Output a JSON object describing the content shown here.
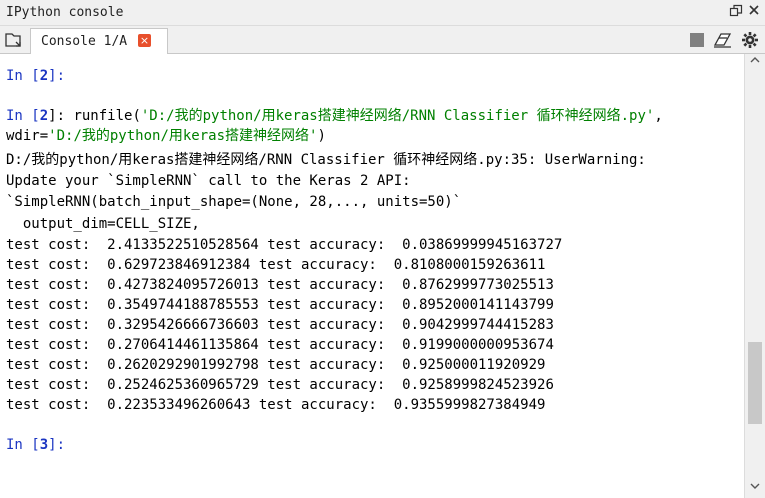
{
  "pane": {
    "title": "IPython console",
    "undock_icon": "undock-icon",
    "close_icon": "close-icon"
  },
  "tab": {
    "label": "Console 1/A",
    "close_label": "×"
  },
  "toolbar": {
    "browse_icon": "browse-tabs-icon",
    "stop_icon": "stop-icon",
    "clear_icon": "eraser-icon",
    "options_icon": "gear-icon"
  },
  "console": {
    "prompt1": {
      "prefix": "In [",
      "num": "2",
      "suffix": "]:"
    },
    "run_line": {
      "prefix": "In [",
      "num": "2",
      "mid": "]: runfile(",
      "path": "'D:/我的python/用keras搭建神经网络/RNN Classifier 循环神经网络.py'",
      "tail": ","
    },
    "wdir_line": {
      "prefix": "wdir=",
      "path": "'D:/我的python/用keras搭建神经网络'",
      "tail": ")"
    },
    "output": [
      "D:/我的python/用keras搭建神经网络/RNN Classifier 循环神经网络.py:35: UserWarning:",
      "Update your `SimpleRNN` call to the Keras 2 API:",
      "`SimpleRNN(batch_input_shape=(None, 28,..., units=50)`",
      "  output_dim=CELL_SIZE,",
      "test cost:  2.4133522510528564 test accuracy:  0.03869999945163727",
      "test cost:  0.629723846912384 test accuracy:  0.8108000159263611",
      "test cost:  0.4273824095726013 test accuracy:  0.8762999773025513",
      "test cost:  0.3549744188785553 test accuracy:  0.8952000141143799",
      "test cost:  0.3295426666736603 test accuracy:  0.9042999744415283",
      "test cost:  0.2706414461135864 test accuracy:  0.9199000000953674",
      "test cost:  0.2620292901992798 test accuracy:  0.925000011920929",
      "test cost:  0.2524625360965729 test accuracy:  0.9258999824523926",
      "test cost:  0.223533496260643 test accuracy:  0.9355999827384949"
    ],
    "prompt2": {
      "prefix": "In [",
      "num": "3",
      "suffix": "]:"
    }
  },
  "colors": {
    "prompt": "#1b35c2",
    "string": "#008000",
    "tab_close": "#e8502c"
  }
}
